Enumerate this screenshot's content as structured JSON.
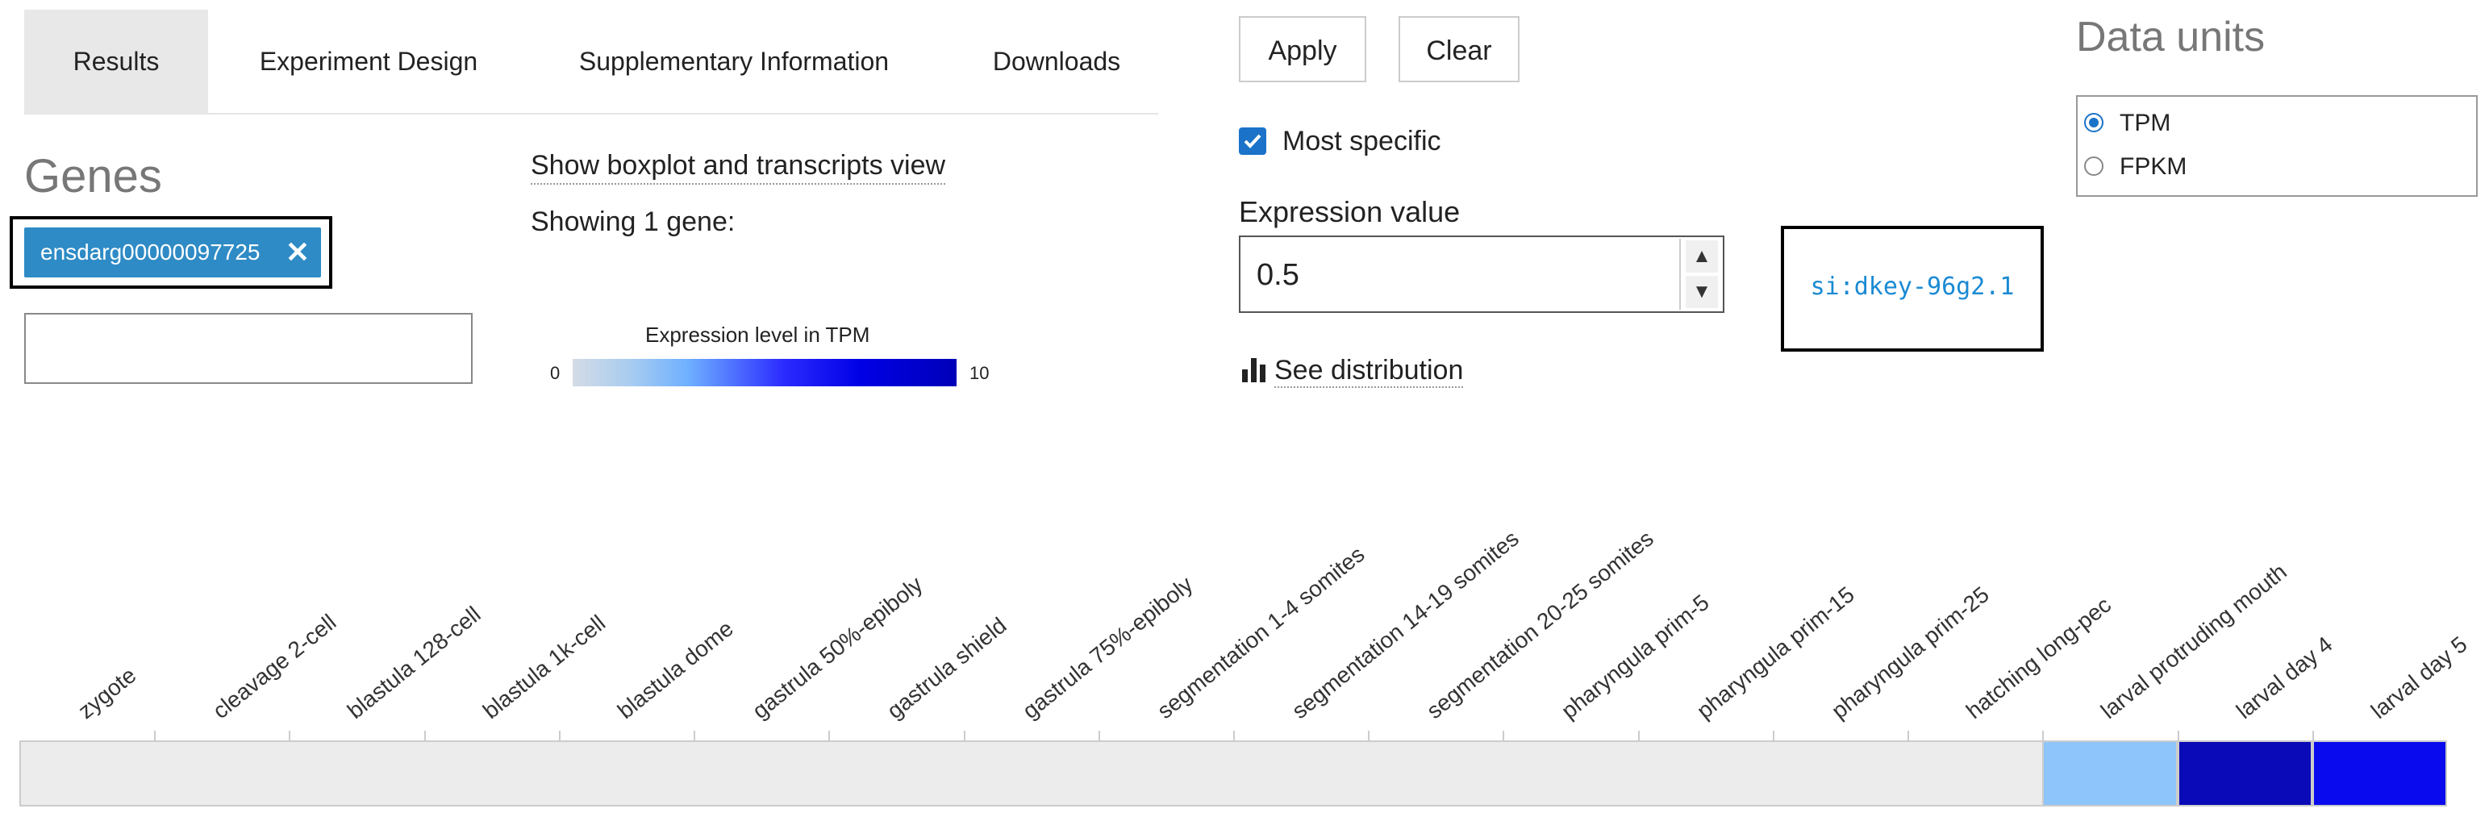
{
  "tabs": [
    {
      "label": "Results",
      "active": true
    },
    {
      "label": "Experiment Design",
      "active": false
    },
    {
      "label": "Supplementary Information",
      "active": false
    },
    {
      "label": "Downloads",
      "active": false
    }
  ],
  "genes": {
    "title": "Genes",
    "chip_label": "ensdarg00000097725",
    "input_value": ""
  },
  "view": {
    "boxplot_link": "Show boxplot and transcripts view",
    "showing_text": "Showing 1 gene:"
  },
  "legend": {
    "title": "Expression level in TPM",
    "min": "0",
    "max": "10"
  },
  "filters": {
    "apply_label": "Apply",
    "clear_label": "Clear",
    "most_specific_label": "Most specific",
    "most_specific_checked": true,
    "expression_label": "Expression value",
    "expression_value": "0.5",
    "distribution_label": "See distribution"
  },
  "gene_name": "si:dkey-96g2.1",
  "data_units": {
    "title": "Data units",
    "options": [
      {
        "label": "TPM",
        "selected": true
      },
      {
        "label": "FPKM",
        "selected": false
      }
    ]
  },
  "heatmap": {
    "columns": [
      "zygote",
      "cleavage 2-cell",
      "blastula 128-cell",
      "blastula 1k-cell",
      "blastula dome",
      "gastrula 50%-epiboly",
      "gastrula shield",
      "gastrula 75%-epiboly",
      "segmentation 1-4 somites",
      "segmentation 14-19 somites",
      "segmentation 20-25 somites",
      "pharyngula prim-5",
      "pharyngula prim-15",
      "pharyngula prim-25",
      "hatching long-pec",
      "larval protruding mouth",
      "larval day 4",
      "larval day 5"
    ],
    "cell_colors": [
      null,
      null,
      null,
      null,
      null,
      null,
      null,
      null,
      null,
      null,
      null,
      null,
      null,
      null,
      null,
      "#8ec5fb",
      "#0a0ab8",
      "#0a0aee"
    ]
  },
  "colors": {
    "accent": "#1a73c9",
    "chip": "#2e8bc5",
    "gene_link": "#1a8ad4"
  }
}
